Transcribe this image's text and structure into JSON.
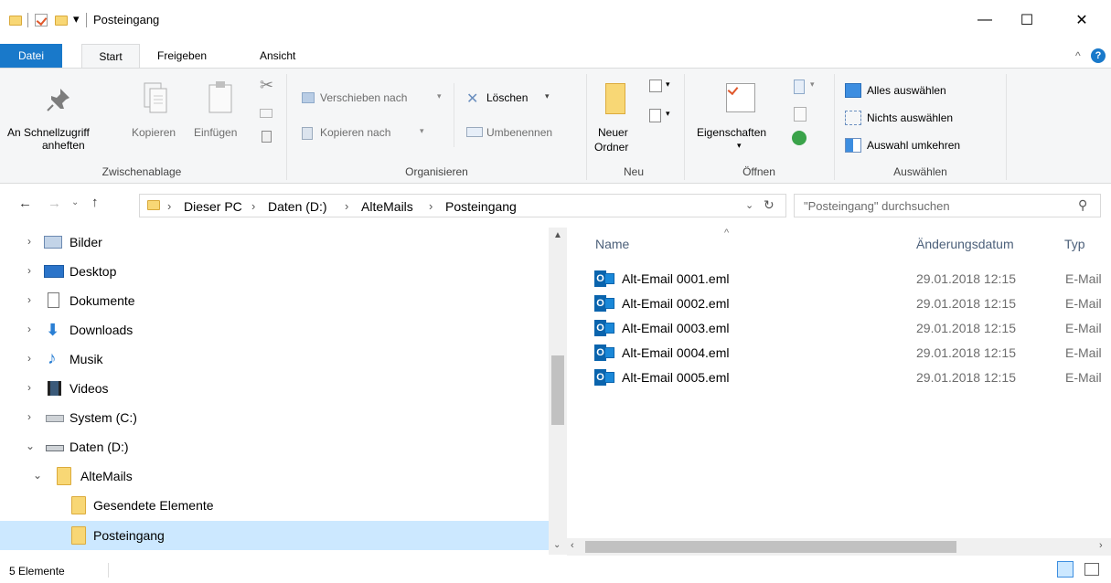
{
  "window": {
    "title": "Posteingang",
    "qa_dropdown": "▾",
    "min": "—",
    "max": "☐",
    "close": "✕"
  },
  "tabs": [
    {
      "label": "Datei"
    },
    {
      "label": "Start"
    },
    {
      "label": "Freigeben"
    },
    {
      "label": "Ansicht"
    }
  ],
  "ribbon": {
    "collapse": "^",
    "help": "?",
    "pin": "An Schnellzugriff\nanheften",
    "pin_line1": "An Schnellzugriff",
    "pin_line2": "anheften",
    "copy": "Kopieren",
    "paste": "Einfügen",
    "clipboard_group": "Zwischenablage",
    "move_to": "Verschieben nach",
    "copy_to": "Kopieren nach",
    "delete": "Löschen",
    "rename": "Umbenennen",
    "organize_group": "Organisieren",
    "new_folder_line1": "Neuer",
    "new_folder_line2": "Ordner",
    "new_group": "Neu",
    "properties": "Eigenschaften",
    "open_group": "Öffnen",
    "select_all": "Alles auswählen",
    "select_none": "Nichts auswählen",
    "invert_selection": "Auswahl umkehren",
    "select_group": "Auswählen"
  },
  "address": {
    "crumbs": [
      "Dieser PC",
      "Daten (D:)",
      "AlteMails",
      "Posteingang"
    ],
    "sep": "›",
    "search_placeholder": "\"Posteingang\" durchsuchen"
  },
  "nav": {
    "items": [
      {
        "label": "Bilder",
        "chev": "›",
        "icon": "pictures-icon"
      },
      {
        "label": "Desktop",
        "chev": "›",
        "icon": "desktop-icon"
      },
      {
        "label": "Dokumente",
        "chev": "›",
        "icon": "documents-icon"
      },
      {
        "label": "Downloads",
        "chev": "›",
        "icon": "downloads-icon"
      },
      {
        "label": "Musik",
        "chev": "›",
        "icon": "music-icon"
      },
      {
        "label": "Videos",
        "chev": "›",
        "icon": "videos-icon"
      },
      {
        "label": "System (C:)",
        "chev": "›",
        "icon": "drive-c-icon"
      },
      {
        "label": "Daten (D:)",
        "chev": "⌄",
        "icon": "drive-d-icon"
      },
      {
        "label": "AlteMails",
        "chev": "⌄",
        "icon": "folder-icon"
      },
      {
        "label": "Gesendete Elemente",
        "chev": "",
        "icon": "folder-icon"
      },
      {
        "label": "Posteingang",
        "chev": "",
        "icon": "folder-icon"
      }
    ]
  },
  "list": {
    "col_name": "Name",
    "col_date": "Änderungsdatum",
    "col_type": "Typ",
    "files": [
      {
        "name": "Alt-Email 0001.eml",
        "date": "29.01.2018 12:15",
        "type": "E-Mail"
      },
      {
        "name": "Alt-Email 0002.eml",
        "date": "29.01.2018 12:15",
        "type": "E-Mail"
      },
      {
        "name": "Alt-Email 0003.eml",
        "date": "29.01.2018 12:15",
        "type": "E-Mail"
      },
      {
        "name": "Alt-Email 0004.eml",
        "date": "29.01.2018 12:15",
        "type": "E-Mail"
      },
      {
        "name": "Alt-Email 0005.eml",
        "date": "29.01.2018 12:15",
        "type": "E-Mail"
      }
    ]
  },
  "status": {
    "count": "5 Elemente"
  }
}
